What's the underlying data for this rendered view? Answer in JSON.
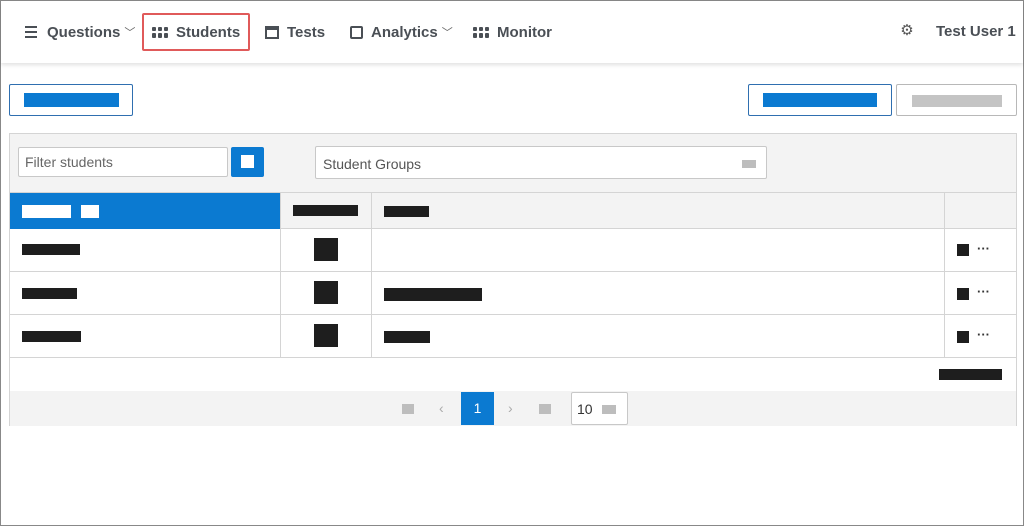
{
  "nav": {
    "items": [
      {
        "label": "Questions",
        "has_chevron": true
      },
      {
        "label": "Students",
        "active": true
      },
      {
        "label": "Tests"
      },
      {
        "label": "Analytics",
        "has_chevron": true
      },
      {
        "label": "Monitor"
      }
    ],
    "chevron": "﹀",
    "user": "Test User 1"
  },
  "filter": {
    "placeholder": "Filter students"
  },
  "groups": {
    "label": "Student Groups"
  },
  "table": {
    "rows": 3,
    "redacted": true
  },
  "pager": {
    "current_page": "1",
    "prev": "‹",
    "next": "›",
    "page_size": "10"
  },
  "colors": {
    "accent": "#0b7ad1",
    "active_outline": "#e05a5a",
    "redaction": "#1e1e1e"
  },
  "icons": {
    "settings": "⚙",
    "more": "···"
  }
}
